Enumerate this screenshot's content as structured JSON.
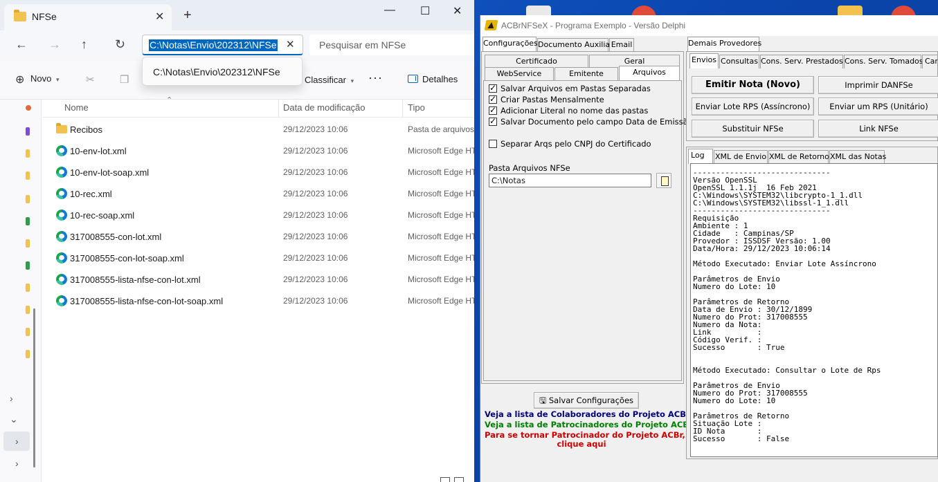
{
  "explorer": {
    "tab_title": "NFSe",
    "new_tab_icon": "+",
    "address": "C:\\Notas\\Envio\\202312\\NFSe",
    "search_placeholder": "Pesquisar em NFSe",
    "autocomplete_item": "C:\\Notas\\Envio\\202312\\NFSe",
    "cmd_new": "Novo",
    "cmd_sort": "Classificar",
    "cmd_details": "Detalhes",
    "columns": {
      "name": "Nome",
      "date": "Data de modificação",
      "type": "Tipo"
    },
    "files": [
      {
        "icon": "folder-icon",
        "name": "Recibos",
        "date": "29/12/2023 10:06",
        "type": "Pasta de arquivos"
      },
      {
        "icon": "edge-icon",
        "name": "10-env-lot.xml",
        "date": "29/12/2023 10:06",
        "type": "Microsoft Edge HT"
      },
      {
        "icon": "edge-icon",
        "name": "10-env-lot-soap.xml",
        "date": "29/12/2023 10:06",
        "type": "Microsoft Edge HT"
      },
      {
        "icon": "edge-icon",
        "name": "10-rec.xml",
        "date": "29/12/2023 10:06",
        "type": "Microsoft Edge HT"
      },
      {
        "icon": "edge-icon",
        "name": "10-rec-soap.xml",
        "date": "29/12/2023 10:06",
        "type": "Microsoft Edge HT"
      },
      {
        "icon": "edge-icon",
        "name": "317008555-con-lot.xml",
        "date": "29/12/2023 10:06",
        "type": "Microsoft Edge HT"
      },
      {
        "icon": "edge-icon",
        "name": "317008555-con-lot-soap.xml",
        "date": "29/12/2023 10:06",
        "type": "Microsoft Edge HT"
      },
      {
        "icon": "edge-icon",
        "name": "317008555-lista-nfse-con-lot.xml",
        "date": "29/12/2023 10:06",
        "type": "Microsoft Edge HT"
      },
      {
        "icon": "edge-icon",
        "name": "317008555-lista-nfse-con-lot-soap.xml",
        "date": "29/12/2023 10:06",
        "type": "Microsoft Edge HT"
      }
    ]
  },
  "acbr": {
    "title": "ACBrNFSeX - Programa Exemplo - Versão Delphi",
    "left_tabs": [
      "Configurações",
      "Documento Auxiliar",
      "Email"
    ],
    "sub_tabs_row1": [
      "Certificado",
      "Geral"
    ],
    "sub_tabs_row2": [
      "WebService",
      "Emitente",
      "Arquivos"
    ],
    "checkboxes": [
      {
        "label": "Salvar Arquivos em Pastas Separadas",
        "checked": true
      },
      {
        "label": "Criar Pastas Mensalmente",
        "checked": true
      },
      {
        "label": "Adicionar Literal no nome das pastas",
        "checked": true
      },
      {
        "label": "Salvar Documento pelo campo Data de Emissão",
        "checked": true
      },
      {
        "label": "Separar Arqs pelo CNPJ do Certificado",
        "checked": false
      }
    ],
    "pasta_label": "Pasta Arquivos NFSe",
    "pasta_value": "C:\\Notas",
    "save_button": "Salvar Configurações",
    "links": [
      {
        "text": "Veja a lista de Colaboradores do Projeto ACBr",
        "color": "#000080"
      },
      {
        "text": "Veja a lista de Patrocinadores do Projeto ACBr",
        "color": "#008000"
      },
      {
        "text": "Para se tornar Patrocinador do Projeto ACBr,",
        "color": "#cc0000"
      },
      {
        "text": "clique aqui",
        "color": "#cc0000"
      }
    ],
    "right_top_tab": "Demais Provedores",
    "right_tabs": [
      "Envios",
      "Consultas",
      "Cons. Serv. Prestados",
      "Cons. Serv. Tomados",
      "Can"
    ],
    "buttons": {
      "emitir": "Emitir Nota (Novo)",
      "imprimir": "Imprimir DANFSe",
      "enviar_lote": "Enviar Lote RPS (Assíncrono)",
      "enviar_um": "Enviar um RPS (Unitário)",
      "substituir": "Substituir NFSe",
      "link": "Link NFSe"
    },
    "log_tabs": [
      "Log",
      "XML de Envio",
      "XML de Retorno",
      "XML das Notas"
    ],
    "log_lines": [
      "------------------------------",
      "Versão OpenSSL",
      "OpenSSL 1.1.1j  16 Feb 2021",
      "C:\\Windows\\SYSTEM32\\libcrypto-1_1.dll",
      "C:\\Windows\\SYSTEM32\\libssl-1_1.dll",
      "------------------------------",
      "Requisição",
      "Ambiente : 1",
      "Cidade   : Campinas/SP",
      "Provedor : ISSDSF Versão: 1.00",
      "Data/Hora: 29/12/2023 10:06:14",
      "",
      "Método Executado: Enviar Lote Assíncrono",
      "",
      "Parâmetros de Envio",
      "Numero do Lote: 10",
      "",
      "Parâmetros de Retorno",
      "Data de Envio : 30/12/1899",
      "Numero do Prot: 317008555",
      "Numero da Nota:",
      "Link          :",
      "Código Verif. :",
      "Sucesso       : True",
      "",
      "",
      "Método Executado: Consultar o Lote de Rps",
      "",
      "Parâmetros de Envio",
      "Numero do Prot: 317008555",
      "Numero do Lote: 10",
      "",
      "Parâmetros de Retorno",
      "Situação Lote :",
      "ID Nota       :",
      "Sucesso       : False"
    ]
  }
}
